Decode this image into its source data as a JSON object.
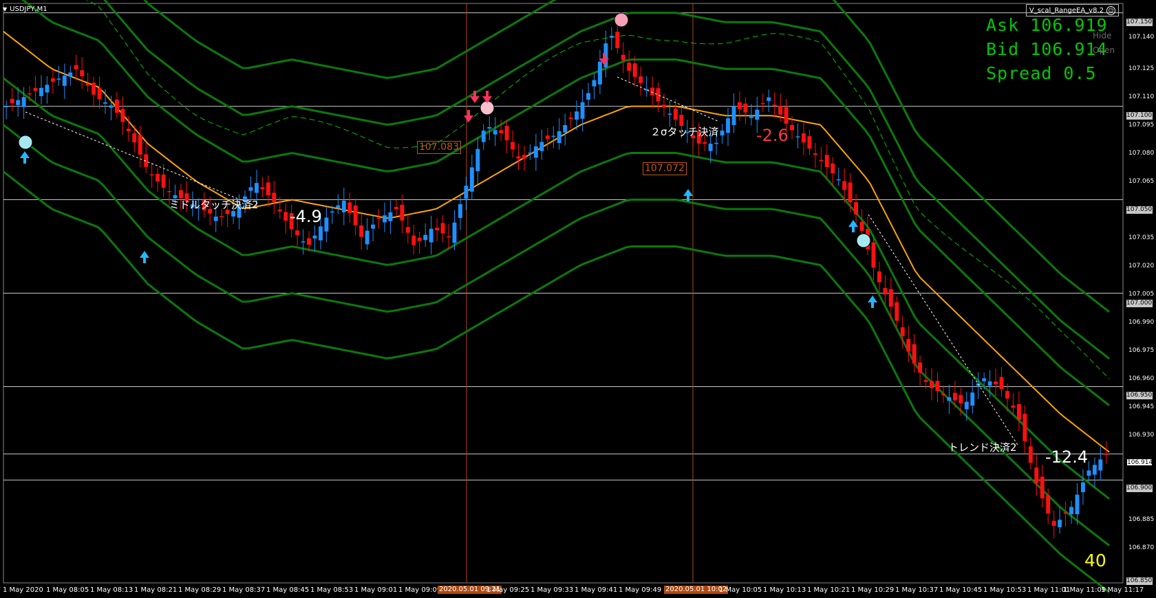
{
  "chart_window": {
    "symbol_title": "USDJPY,M1",
    "ea_name": "V_scal_RangeEA_v8.2",
    "ea_icon": "smiley-face-icon"
  },
  "quote": {
    "ask": "Ask 106.919",
    "bid": "Bid 106.914",
    "spread": "Spread 0.5"
  },
  "side_buttons": {
    "hide": "Hide",
    "open": "Open"
  },
  "price_axis": {
    "ticks": [
      "107.140",
      "107.125",
      "107.110",
      "107.095",
      "107.080",
      "107.065",
      "107.035",
      "107.020",
      "107.005",
      "106.990",
      "106.975",
      "106.960",
      "106.945",
      "106.930",
      "106.885",
      "106.870"
    ],
    "level_boxes": [
      "107.150",
      "107.100",
      "107.050",
      "107.000",
      "106.950",
      "106.900",
      "106.850"
    ],
    "bid_box": "106.914"
  },
  "time_axis": {
    "ticks": [
      "1 May 2020",
      "1 May 08:05",
      "1 May 08:13",
      "1 May 08:21",
      "1 May 08:29",
      "1 May 08:37",
      "1 May 08:45",
      "1 May 08:53",
      "1 May 09:01",
      "1 May 09:09",
      "1 May 09:25",
      "1 May 09:33",
      "1 May 09:41",
      "1 May 09:49",
      "1 May 10:05",
      "1 May 10:13",
      "1 May 10:21",
      "1 May 10:29",
      "1 May 10:37",
      "1 May 10:45",
      "1 May 10:53",
      "1 May 11:01",
      "1 May 11:09",
      "1 May 11:17"
    ],
    "highlights": [
      "2020.05.01 09:21",
      "2020.05.01 10:02"
    ]
  },
  "annotations": {
    "middle_touch": "ミドルタッチ決済2",
    "sigma_touch": "２σタッチ決済",
    "trend_settle": "トレンド決済2",
    "pl_1": "-4.9",
    "pl_2": "-2.6",
    "pl_3": "-12.4",
    "count": "40",
    "price_tag_1": "107.083",
    "price_tag_2": "107.072",
    "marker_1": "1",
    "marker_2": "2"
  },
  "colors": {
    "background": "#000000",
    "bull_candle": "#1e90ff",
    "bear_candle": "#ff1010",
    "bollinger": "#0a7a0a",
    "ma": "#ffa500",
    "quote_text": "#00c800",
    "level_line": "#c8c8c8"
  },
  "chart_data": {
    "type": "candlestick",
    "symbol": "USDJPY",
    "timeframe": "M1",
    "y_range": [
      106.845,
      107.155
    ],
    "horizontal_levels": [
      107.15,
      107.1,
      107.05,
      107.0,
      106.95,
      106.914,
      106.9
    ],
    "close_path": [
      107.1,
      107.105,
      107.11,
      107.115,
      107.12,
      107.105,
      107.1,
      107.085,
      107.065,
      107.055,
      107.05,
      107.045,
      107.04,
      107.045,
      107.06,
      107.05,
      107.035,
      107.025,
      107.04,
      107.05,
      107.03,
      107.04,
      107.045,
      107.025,
      107.035,
      107.03,
      107.06,
      107.09,
      107.085,
      107.07,
      107.08,
      107.085,
      107.095,
      107.11,
      107.14,
      107.12,
      107.11,
      107.1,
      107.09,
      107.08,
      107.08,
      107.1,
      107.095,
      107.105,
      107.09,
      107.08,
      107.07,
      107.06,
      107.04,
      107.01,
      106.99,
      106.965,
      106.95,
      106.945,
      106.94,
      106.955,
      106.95,
      106.935,
      106.9,
      106.875,
      106.885,
      106.905,
      106.914
    ],
    "moving_average": [
      107.14,
      107.12,
      107.11,
      107.08,
      107.06,
      107.045,
      107.05,
      107.045,
      107.04,
      107.045,
      107.06,
      107.075,
      107.09,
      107.1,
      107.1,
      107.095,
      107.095,
      107.09,
      107.06,
      107.01,
      106.985,
      106.96,
      106.935,
      106.915
    ]
  }
}
